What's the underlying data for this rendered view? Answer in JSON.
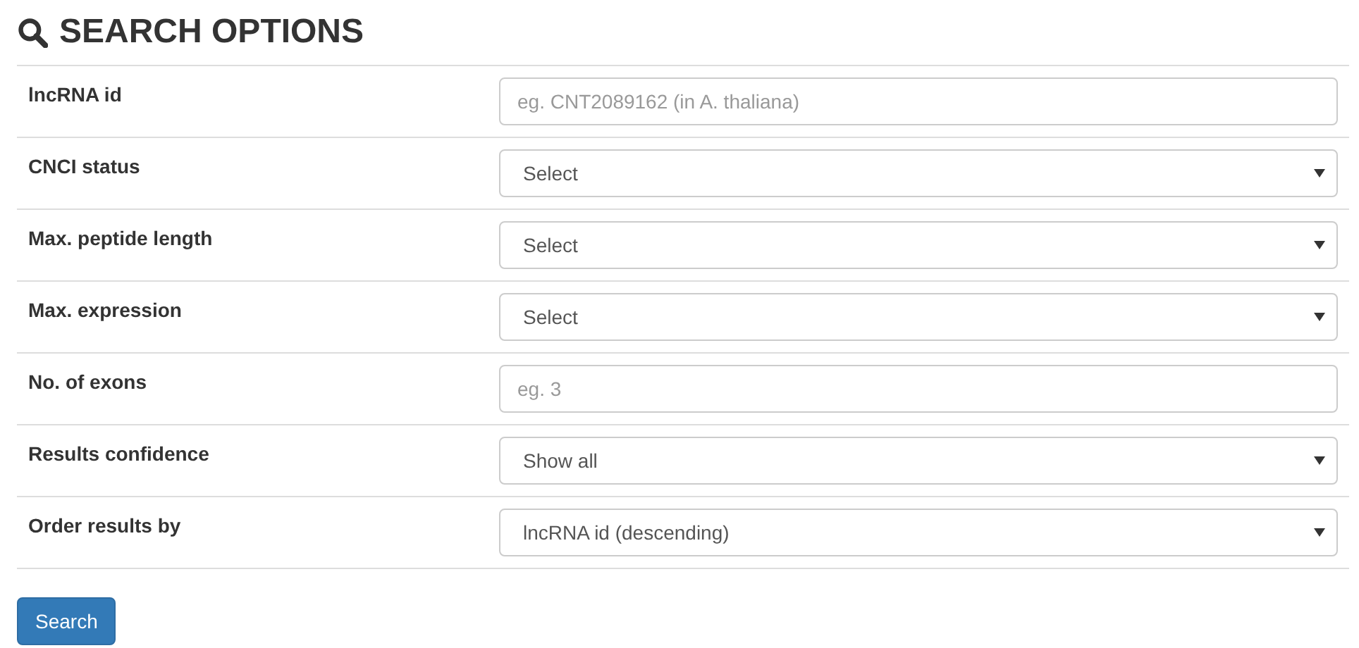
{
  "title": "SEARCH OPTIONS",
  "fields": [
    {
      "label": "lncRNA id",
      "kind": "text",
      "placeholder": "eg. CNT2089162 (in A. thaliana)"
    },
    {
      "label": "CNCI status",
      "kind": "select",
      "value": "Select"
    },
    {
      "label": "Max. peptide length",
      "kind": "select",
      "value": "Select"
    },
    {
      "label": "Max. expression",
      "kind": "select",
      "value": "Select"
    },
    {
      "label": "No. of exons",
      "kind": "text",
      "placeholder": "eg. 3"
    },
    {
      "label": "Results confidence",
      "kind": "select",
      "value": "Show all"
    },
    {
      "label": "Order results by",
      "kind": "select",
      "value": "lncRNA id (descending)"
    }
  ],
  "button": "Search"
}
